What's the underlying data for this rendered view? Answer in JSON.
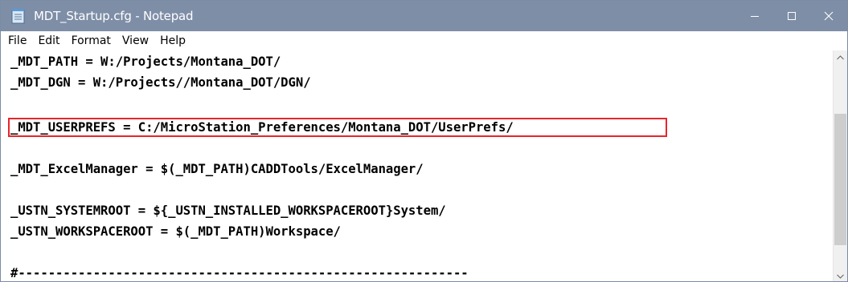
{
  "window": {
    "title": "MDT_Startup.cfg - Notepad",
    "app_icon": "notepad-icon",
    "controls": [
      "minimize-icon",
      "maximize-icon",
      "close-icon"
    ]
  },
  "menu": {
    "items": [
      "File",
      "Edit",
      "Format",
      "View",
      "Help"
    ]
  },
  "editor": {
    "lines": [
      "_MDT_PATH = W:/Projects/Montana_DOT/",
      "_MDT_DGN = W:/Projects//Montana_DOT/DGN/",
      "_MDT_USERPREFS = C:/MicroStation_Preferences/Montana_DOT/UserPrefs/",
      "",
      "_MDT_ExcelManager = $(_MDT_PATH)CADDTools/ExcelManager/",
      "",
      "_USTN_SYSTEMROOT = ${_USTN_INSTALLED_WORKSPACEROOT}System/",
      "_USTN_WORKSPACEROOT = $(_MDT_PATH)Workspace/",
      "",
      "#------------------------------------------------------------"
    ],
    "highlighted_line": 2,
    "highlight_color": "#e8262b"
  },
  "scrollbar": {
    "up": "scroll-up-icon",
    "down": "scroll-down-icon"
  },
  "colors": {
    "titlebar": "#7e8ea7",
    "highlight": "#e8262b"
  }
}
